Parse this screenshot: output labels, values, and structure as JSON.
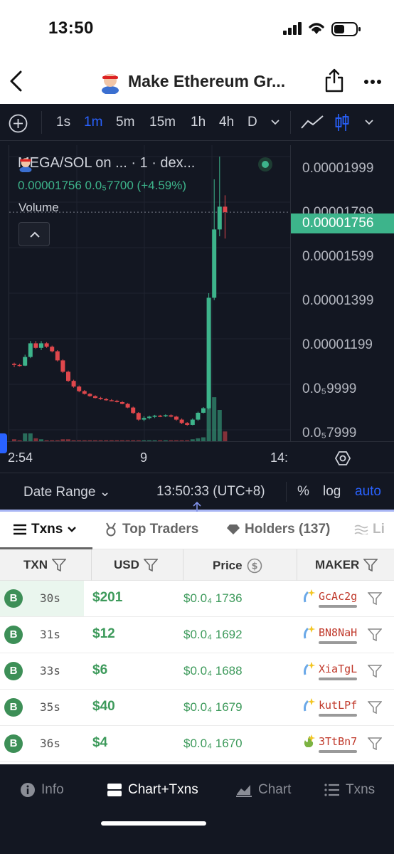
{
  "status_bar": {
    "time": "13:50"
  },
  "header": {
    "title": "Make Ethereum Gr..."
  },
  "toolbar": {
    "timeframes": [
      "1s",
      "1m",
      "5m",
      "15m",
      "1h",
      "4h",
      "D"
    ],
    "active_timeframe": "1m"
  },
  "chart": {
    "legend_title": "MEGA/SOL on ...  · 1 · dex...",
    "legend_values": "0.00001756  0.0₅7700 (+4.59%)",
    "volume_label": "Volume",
    "current_price": "0.00001756",
    "price_labels": [
      "0.00001999",
      "0.00001799",
      "0.00001599",
      "0.00001399",
      "0.00001199",
      "0.0₅9999",
      "0.0₅7999"
    ],
    "time_labels": [
      "2:54",
      "9",
      "14:"
    ],
    "date_range_label": "Date Range",
    "clock": "13:50:33 (UTC+8)",
    "options": [
      "%",
      "log",
      "auto"
    ],
    "colors": {
      "up": "#3db48b",
      "down": "#e0474c",
      "background": "#131722",
      "accent": "#2962ff"
    }
  },
  "chart_data": {
    "type": "candlestick",
    "title": "MEGA/SOL",
    "interval": "1m",
    "ylim": [
      7.5e-06,
      2.05e-05
    ],
    "price_axis_ticks": [
      1.999e-05,
      1.799e-05,
      1.599e-05,
      1.399e-05,
      1.199e-05,
      9.999e-06,
      7.999e-06
    ],
    "last_price": 1.756e-05,
    "change": 7.7e-07,
    "change_pct": 4.59,
    "x_tick_labels": [
      "2:54",
      "9",
      "14:"
    ],
    "candles": [
      {
        "o": 1.09,
        "h": 1.095,
        "l": 1.075,
        "c": 1.085
      },
      {
        "o": 1.085,
        "h": 1.09,
        "l": 1.078,
        "c": 1.082
      },
      {
        "o": 1.082,
        "h": 1.13,
        "l": 1.08,
        "c": 1.12
      },
      {
        "o": 1.12,
        "h": 1.19,
        "l": 1.115,
        "c": 1.18
      },
      {
        "o": 1.18,
        "h": 1.19,
        "l": 1.155,
        "c": 1.16
      },
      {
        "o": 1.16,
        "h": 1.19,
        "l": 1.15,
        "c": 1.18
      },
      {
        "o": 1.18,
        "h": 1.185,
        "l": 1.16,
        "c": 1.165
      },
      {
        "o": 1.165,
        "h": 1.17,
        "l": 1.14,
        "c": 1.145
      },
      {
        "o": 1.145,
        "h": 1.15,
        "l": 1.1,
        "c": 1.105
      },
      {
        "o": 1.105,
        "h": 1.11,
        "l": 1.05,
        "c": 1.055
      },
      {
        "o": 1.055,
        "h": 1.06,
        "l": 1.01,
        "c": 1.015
      },
      {
        "o": 1.015,
        "h": 1.02,
        "l": 0.985,
        "c": 0.99
      },
      {
        "o": 0.99,
        "h": 0.995,
        "l": 0.965,
        "c": 0.97
      },
      {
        "o": 0.97,
        "h": 0.975,
        "l": 0.955,
        "c": 0.958
      },
      {
        "o": 0.958,
        "h": 0.962,
        "l": 0.945,
        "c": 0.948
      },
      {
        "o": 0.948,
        "h": 0.952,
        "l": 0.938,
        "c": 0.94
      },
      {
        "o": 0.94,
        "h": 0.945,
        "l": 0.932,
        "c": 0.935
      },
      {
        "o": 0.935,
        "h": 0.94,
        "l": 0.928,
        "c": 0.93
      },
      {
        "o": 0.93,
        "h": 0.935,
        "l": 0.925,
        "c": 0.927
      },
      {
        "o": 0.927,
        "h": 0.932,
        "l": 0.92,
        "c": 0.922
      },
      {
        "o": 0.922,
        "h": 0.926,
        "l": 0.912,
        "c": 0.914
      },
      {
        "o": 0.914,
        "h": 0.918,
        "l": 0.895,
        "c": 0.898
      },
      {
        "o": 0.898,
        "h": 0.902,
        "l": 0.87,
        "c": 0.874
      },
      {
        "o": 0.874,
        "h": 0.878,
        "l": 0.84,
        "c": 0.845
      },
      {
        "o": 0.845,
        "h": 0.86,
        "l": 0.838,
        "c": 0.852
      },
      {
        "o": 0.852,
        "h": 0.862,
        "l": 0.846,
        "c": 0.858
      },
      {
        "o": 0.858,
        "h": 0.866,
        "l": 0.852,
        "c": 0.862
      },
      {
        "o": 0.862,
        "h": 0.866,
        "l": 0.856,
        "c": 0.86
      },
      {
        "o": 0.86,
        "h": 0.868,
        "l": 0.856,
        "c": 0.864
      },
      {
        "o": 0.864,
        "h": 0.868,
        "l": 0.855,
        "c": 0.858
      },
      {
        "o": 0.858,
        "h": 0.862,
        "l": 0.84,
        "c": 0.845
      },
      {
        "o": 0.845,
        "h": 0.85,
        "l": 0.825,
        "c": 0.83
      },
      {
        "o": 0.83,
        "h": 0.834,
        "l": 0.818,
        "c": 0.822
      },
      {
        "o": 0.822,
        "h": 0.85,
        "l": 0.82,
        "c": 0.845
      },
      {
        "o": 0.845,
        "h": 0.88,
        "l": 0.84,
        "c": 0.875
      },
      {
        "o": 0.875,
        "h": 0.9,
        "l": 0.872,
        "c": 0.895
      },
      {
        "o": 0.895,
        "h": 1.4,
        "l": 0.89,
        "c": 1.38
      },
      {
        "o": 1.38,
        "h": 1.9,
        "l": 1.37,
        "c": 1.68
      },
      {
        "o": 1.68,
        "h": 2.0,
        "l": 1.65,
        "c": 1.78
      },
      {
        "o": 1.78,
        "h": 1.83,
        "l": 1.64,
        "c": 1.756
      }
    ],
    "candle_scale": "x 1e-5",
    "volumes": [
      2,
      1,
      8,
      8,
      3,
      2,
      1,
      1,
      1,
      2,
      2,
      1,
      1,
      1,
      1,
      1,
      1,
      1,
      1,
      1,
      1,
      1,
      1,
      1,
      1,
      1,
      1,
      1,
      1,
      1,
      1,
      1,
      1,
      2,
      3,
      4,
      80,
      45,
      32,
      10
    ]
  },
  "tabs": [
    {
      "label": "Txns",
      "active": true
    },
    {
      "label": "Top Traders",
      "active": false
    },
    {
      "label": "Holders (137)",
      "active": false
    },
    {
      "label": "Li",
      "active": false
    }
  ],
  "table": {
    "headers": [
      "TXN",
      "USD",
      "Price",
      "MAKER"
    ],
    "rows": [
      {
        "type": "B",
        "age": "30s",
        "usd": "$201",
        "price": "$0.0₄ 1736",
        "maker": "GcAc2g"
      },
      {
        "type": "B",
        "age": "31s",
        "usd": "$12",
        "price": "$0.0₄ 1692",
        "maker": "BN8NaH"
      },
      {
        "type": "B",
        "age": "33s",
        "usd": "$6",
        "price": "$0.0₄ 1688",
        "maker": "XiaTgL"
      },
      {
        "type": "B",
        "age": "35s",
        "usd": "$40",
        "price": "$0.0₄ 1679",
        "maker": "kutLPf"
      },
      {
        "type": "B",
        "age": "36s",
        "usd": "$4",
        "price": "$0.0₄ 1670",
        "maker": "3TtBn7"
      }
    ]
  },
  "bottom_nav": [
    {
      "label": "Info",
      "icon": "info-icon",
      "active": false
    },
    {
      "label": "Chart+Txns",
      "icon": "split-icon",
      "active": true
    },
    {
      "label": "Chart",
      "icon": "chart-icon",
      "active": false
    },
    {
      "label": "Txns",
      "icon": "list-icon",
      "active": false
    }
  ]
}
